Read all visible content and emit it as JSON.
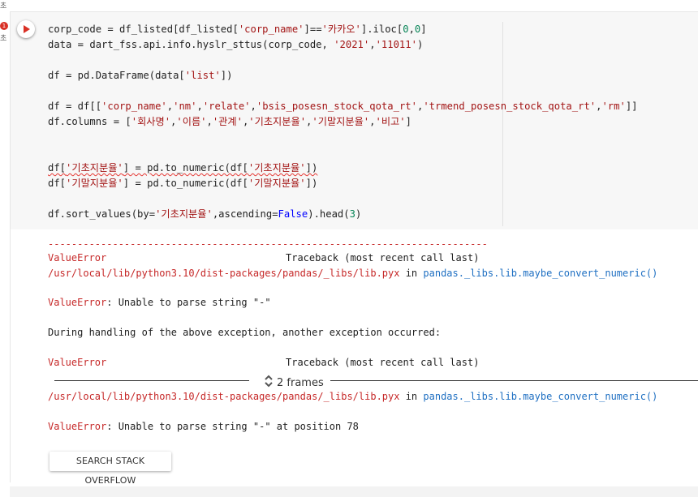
{
  "gutter": {
    "top_label": "초",
    "badge": "1",
    "mark": "초"
  },
  "code_cell": {
    "lines": [
      {
        "segments": [
          {
            "t": "corp_code = df_listed[df_listed[",
            "c": "p"
          },
          {
            "t": "'corp_name'",
            "c": "s"
          },
          {
            "t": "]==",
            "c": "p"
          },
          {
            "t": "'카카오'",
            "c": "s"
          },
          {
            "t": "].iloc[",
            "c": "p"
          },
          {
            "t": "0",
            "c": "n"
          },
          {
            "t": ",",
            "c": "p"
          },
          {
            "t": "0",
            "c": "n"
          },
          {
            "t": "]",
            "c": "p"
          }
        ]
      },
      {
        "segments": [
          {
            "t": "data = dart_fss.api.info.hyslr_sttus(corp_code, ",
            "c": "p"
          },
          {
            "t": "'2021'",
            "c": "s"
          },
          {
            "t": ",",
            "c": "p"
          },
          {
            "t": "'11011'",
            "c": "s"
          },
          {
            "t": ")",
            "c": "p"
          }
        ]
      },
      {
        "segments": []
      },
      {
        "segments": [
          {
            "t": "df = pd.DataFrame(data[",
            "c": "p"
          },
          {
            "t": "'list'",
            "c": "s"
          },
          {
            "t": "])",
            "c": "p"
          }
        ]
      },
      {
        "segments": []
      },
      {
        "segments": [
          {
            "t": "df = df[[",
            "c": "p"
          },
          {
            "t": "'corp_name'",
            "c": "s"
          },
          {
            "t": ",",
            "c": "p"
          },
          {
            "t": "'nm'",
            "c": "s"
          },
          {
            "t": ",",
            "c": "p"
          },
          {
            "t": "'relate'",
            "c": "s"
          },
          {
            "t": ",",
            "c": "p"
          },
          {
            "t": "'bsis_posesn_stock_qota_rt'",
            "c": "s"
          },
          {
            "t": ",",
            "c": "p"
          },
          {
            "t": "'trmend_posesn_stock_qota_rt'",
            "c": "s"
          },
          {
            "t": ",",
            "c": "p"
          },
          {
            "t": "'rm'",
            "c": "s"
          },
          {
            "t": "]]",
            "c": "p"
          }
        ]
      },
      {
        "segments": [
          {
            "t": "df.columns = [",
            "c": "p"
          },
          {
            "t": "'회사명'",
            "c": "s"
          },
          {
            "t": ",",
            "c": "p"
          },
          {
            "t": "'이름'",
            "c": "s"
          },
          {
            "t": ",",
            "c": "p"
          },
          {
            "t": "'관계'",
            "c": "s"
          },
          {
            "t": ",",
            "c": "p"
          },
          {
            "t": "'기초지분율'",
            "c": "s"
          },
          {
            "t": ",",
            "c": "p"
          },
          {
            "t": "'기말지분율'",
            "c": "s"
          },
          {
            "t": ",",
            "c": "p"
          },
          {
            "t": "'비고'",
            "c": "s"
          },
          {
            "t": "]",
            "c": "p"
          }
        ]
      },
      {
        "segments": []
      },
      {
        "segments": []
      },
      {
        "segments": [
          {
            "t": "df[",
            "c": "p",
            "sq": true
          },
          {
            "t": "'기초지분율'",
            "c": "s",
            "sq": true
          },
          {
            "t": "] = pd.to_numeric(df[",
            "c": "p",
            "sq": true
          },
          {
            "t": "'기초지분율'",
            "c": "s",
            "sq": true
          },
          {
            "t": "])",
            "c": "p",
            "sq": true
          }
        ]
      },
      {
        "segments": [
          {
            "t": "df[",
            "c": "p"
          },
          {
            "t": "'기말지분율'",
            "c": "s"
          },
          {
            "t": "] = pd.to_numeric(df[",
            "c": "p"
          },
          {
            "t": "'기말지분율'",
            "c": "s"
          },
          {
            "t": "])",
            "c": "p"
          }
        ]
      },
      {
        "segments": []
      },
      {
        "segments": [
          {
            "t": "df.sort_values(by=",
            "c": "p"
          },
          {
            "t": "'기초지분율'",
            "c": "s"
          },
          {
            "t": ",ascending=",
            "c": "p"
          },
          {
            "t": "False",
            "c": "k"
          },
          {
            "t": ").head(",
            "c": "p"
          },
          {
            "t": "3",
            "c": "n"
          },
          {
            "t": ")",
            "c": "p"
          }
        ]
      }
    ]
  },
  "output": {
    "separator": "---------------------------------------------------------------------------",
    "tb1": {
      "error": "ValueError",
      "header": "Traceback (most recent call last)"
    },
    "path1": {
      "file": "/usr/local/lib/python3.10/dist-packages/pandas/_libs/lib.pyx",
      "in": " in ",
      "func": "pandas._libs.lib.maybe_convert_numeric()"
    },
    "err1": {
      "name": "ValueError",
      "msg": ": Unable to parse string \"-\""
    },
    "during": "During handling of the above exception, another exception occurred:",
    "tb2": {
      "error": "ValueError",
      "header": "Traceback (most recent call last)"
    },
    "frames_label": "2 frames",
    "path2": {
      "file": "/usr/local/lib/python3.10/dist-packages/pandas/_libs/lib.pyx",
      "in": " in ",
      "func": "pandas._libs.lib.maybe_convert_numeric()"
    },
    "err2": {
      "name": "ValueError",
      "msg": ": Unable to parse string \"-\" at position 78"
    }
  },
  "buttons": {
    "search_so": "SEARCH STACK OVERFLOW"
  },
  "colors": {
    "string": "#a31515",
    "number": "#098658",
    "keyword": "#0000ff",
    "error": "#c62828",
    "link": "#1e6fc2",
    "run": "#d93025"
  },
  "icons": {
    "run": "play-circle-icon",
    "expand": "unfold-icon",
    "error_badge": "error-badge-icon"
  }
}
